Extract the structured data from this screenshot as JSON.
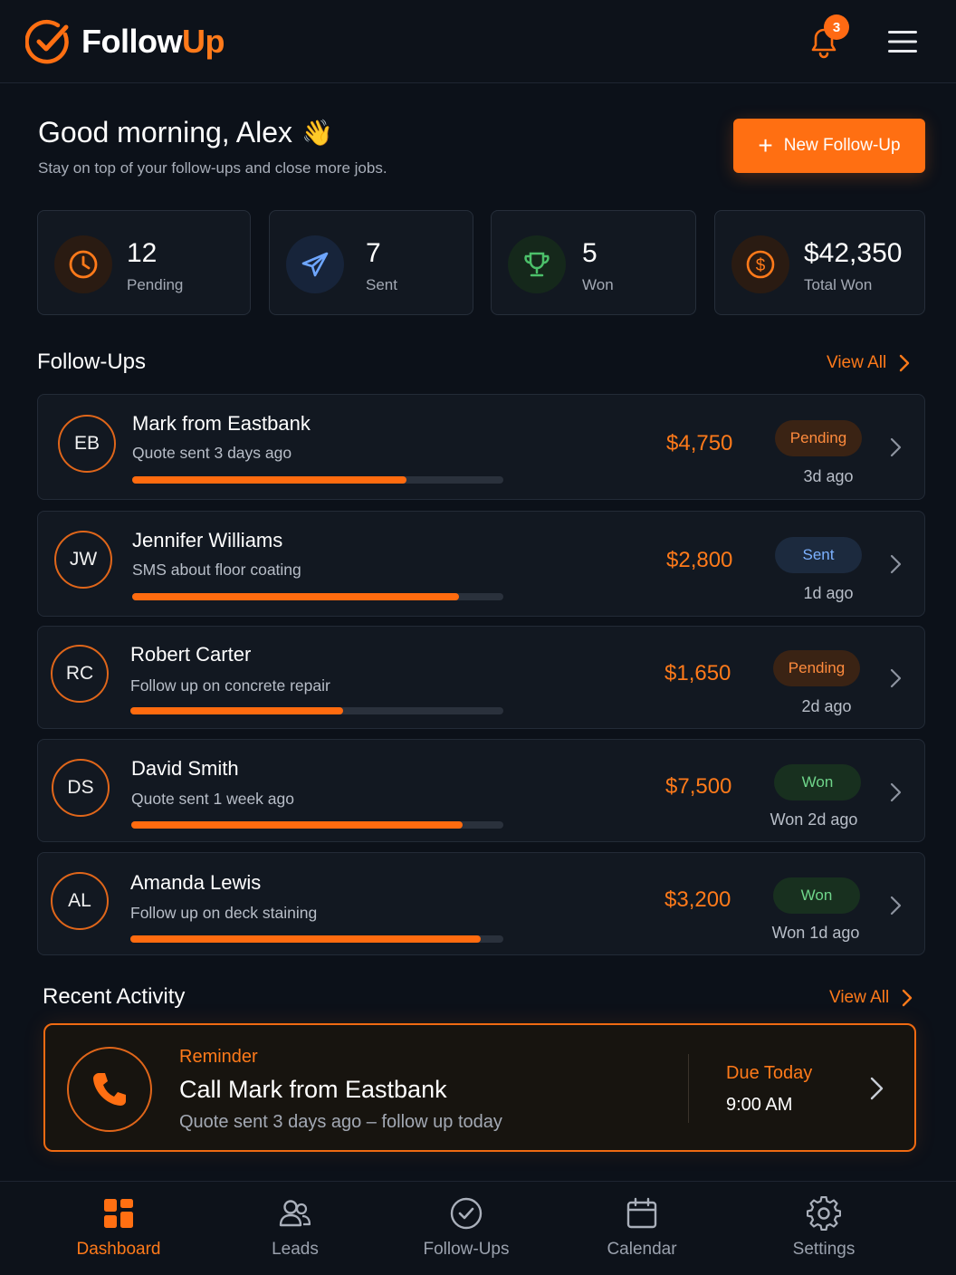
{
  "app": {
    "name_part1": "Follow",
    "name_part2": "Up"
  },
  "header": {
    "notification_count": "3"
  },
  "greeting": {
    "title": "Good morning, Alex",
    "emoji": "👋",
    "subtitle": "Stay on top of your follow-ups and close more jobs."
  },
  "new_button": {
    "label": "New Follow-Up"
  },
  "stats": [
    {
      "value": "12",
      "label": "Pending",
      "icon": "clock-icon",
      "color": "#ff7a1a"
    },
    {
      "value": "7",
      "label": "Sent",
      "icon": "paper-plane-icon",
      "color": "#6ea6ff"
    },
    {
      "value": "5",
      "label": "Won",
      "icon": "trophy-icon",
      "color": "#4cc06a"
    },
    {
      "value": "$42,350",
      "label": "Total Won",
      "icon": "dollar-icon",
      "color": "#ff7a1a"
    }
  ],
  "followups": {
    "title": "Follow-Ups",
    "view_all": "View All",
    "items": [
      {
        "initials": "EB",
        "name": "Mark from Eastbank",
        "desc": "Quote sent 3 days ago",
        "progress": 0.74,
        "amount": "$4,750",
        "status": "Pending",
        "ago": "3d ago"
      },
      {
        "initials": "JW",
        "name": "Jennifer Williams",
        "desc": "SMS about floor coating",
        "progress": 0.88,
        "amount": "$2,800",
        "status": "Sent",
        "ago": "1d ago"
      },
      {
        "initials": "RC",
        "name": "Robert Carter",
        "desc": "Follow up on concrete repair",
        "progress": 0.57,
        "amount": "$1,650",
        "status": "Pending",
        "ago": "2d ago"
      },
      {
        "initials": "DS",
        "name": "David Smith",
        "desc": "Quote sent 1 week ago",
        "progress": 0.89,
        "amount": "$7,500",
        "status": "Won",
        "ago": "Won 2d ago"
      },
      {
        "initials": "AL",
        "name": "Amanda Lewis",
        "desc": "Follow up on deck staining",
        "progress": 0.94,
        "amount": "$3,200",
        "status": "Won",
        "ago": "Won 1d ago"
      }
    ]
  },
  "activity": {
    "title": "Recent Activity",
    "view_all": "View All",
    "reminder": {
      "kicker": "Reminder",
      "title": "Call Mark from Eastbank",
      "subtitle": "Quote sent 3 days ago – follow up today",
      "due": "Due Today",
      "time": "9:00 AM"
    }
  },
  "nav": [
    {
      "label": "Dashboard",
      "icon": "dashboard-icon",
      "active": true
    },
    {
      "label": "Leads",
      "icon": "users-icon",
      "active": false
    },
    {
      "label": "Follow-Ups",
      "icon": "check-circle-icon",
      "active": false
    },
    {
      "label": "Calendar",
      "icon": "calendar-icon",
      "active": false
    },
    {
      "label": "Settings",
      "icon": "gear-icon",
      "active": false
    }
  ],
  "colors": {
    "accent": "#ff6f12",
    "background": "#0c1119",
    "card": "#121821"
  }
}
